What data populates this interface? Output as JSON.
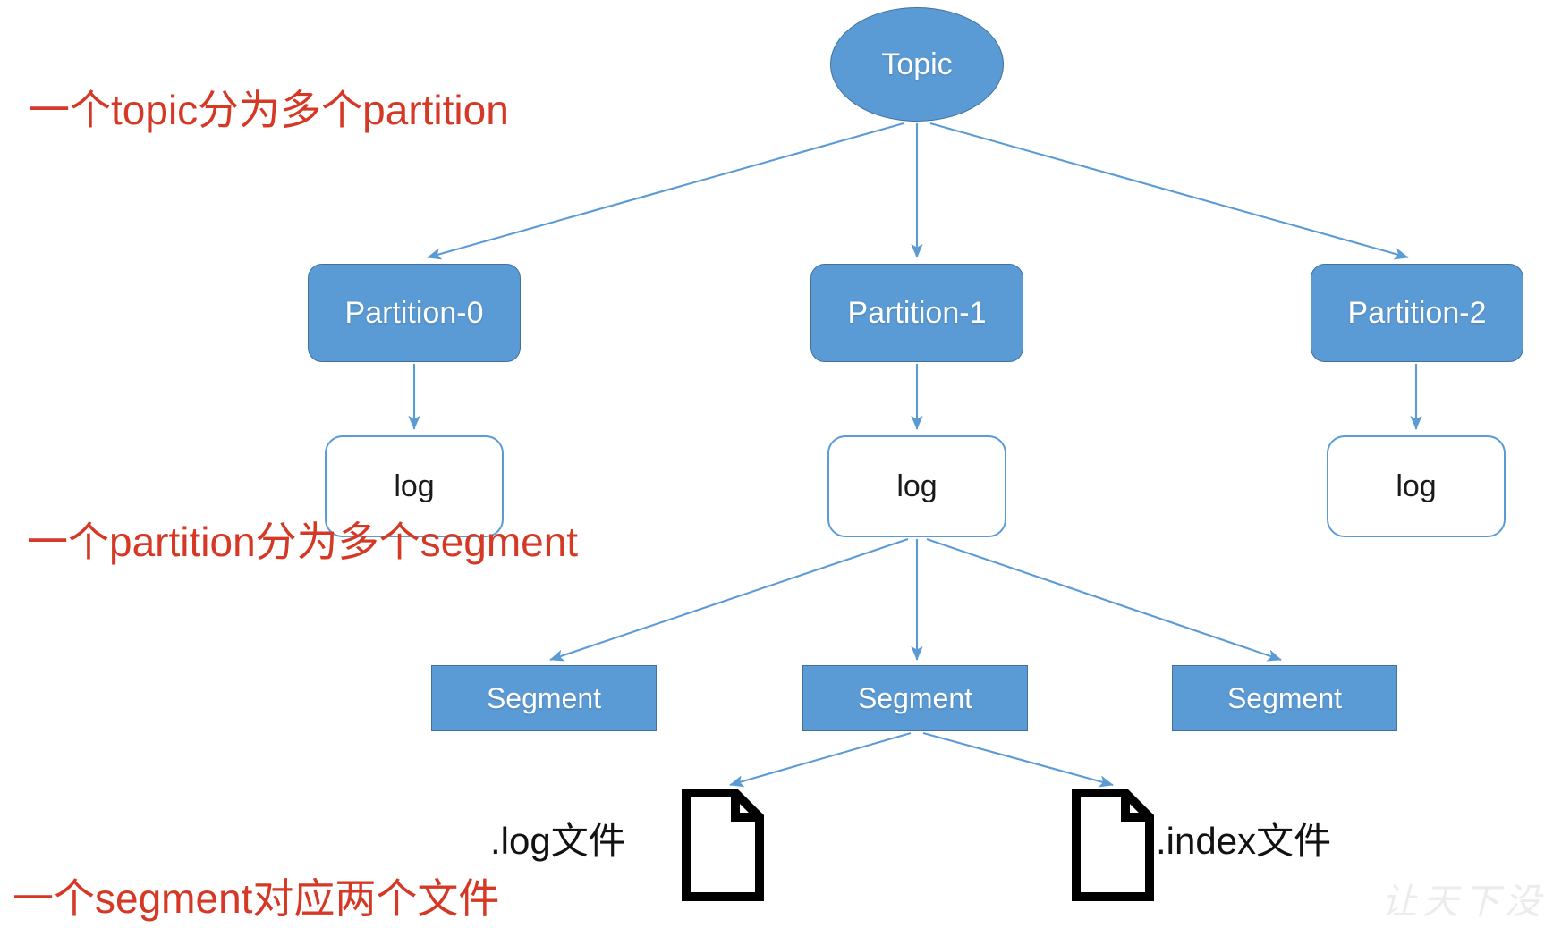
{
  "diagram": {
    "title": "Kafka Topic / Partition / Segment structure",
    "colors": {
      "node_fill": "#5b9bd5",
      "node_border": "#41719c",
      "log_fill": "#ffffff",
      "log_border": "#5b9bd5",
      "edge": "#5b9bd5",
      "annotation_text": "#d63826",
      "node_text": "#ffffff",
      "log_text": "#1a1a1a",
      "file_icon": "#000000",
      "watermark": "#ececec",
      "background": "#ffffff"
    },
    "root": {
      "label": "Topic",
      "shape": "ellipse"
    },
    "partitions": [
      {
        "label": "Partition-0"
      },
      {
        "label": "Partition-1"
      },
      {
        "label": "Partition-2"
      }
    ],
    "logs": [
      {
        "label": "log"
      },
      {
        "label": "log"
      },
      {
        "label": "log"
      }
    ],
    "segments": [
      {
        "label": "Segment"
      },
      {
        "label": "Segment"
      },
      {
        "label": "Segment"
      }
    ],
    "files": [
      {
        "label": ".log文件",
        "icon": "document-icon"
      },
      {
        "label": ".index文件",
        "icon": "document-icon"
      }
    ],
    "annotations": [
      {
        "text": "一个topic分为多个partition"
      },
      {
        "text": "一个partition分为多个segment"
      },
      {
        "text": "一个segment对应两个文件"
      }
    ],
    "watermark": "让天下没"
  }
}
